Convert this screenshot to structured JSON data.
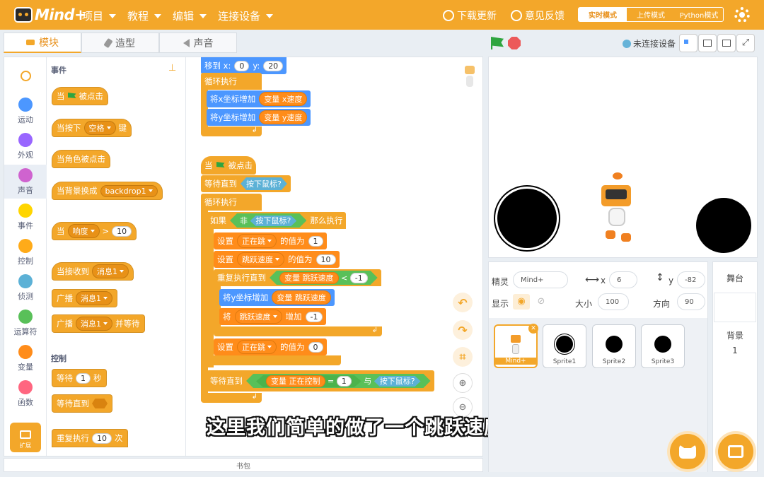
{
  "app": {
    "logo_text": "Mind+"
  },
  "menu": [
    {
      "label": "项目"
    },
    {
      "label": "教程"
    },
    {
      "label": "编辑"
    },
    {
      "label": "连接设备"
    }
  ],
  "topright": {
    "download": "下载更新",
    "feedback": "意见反馈",
    "modes": [
      "实时模式",
      "上传模式",
      "Python模式"
    ]
  },
  "tabs": [
    {
      "label": "模块",
      "icon": "blocks-icon"
    },
    {
      "label": "造型",
      "icon": "brush-icon"
    },
    {
      "label": "声音",
      "icon": "speaker-icon"
    }
  ],
  "categories": [
    {
      "label": "",
      "icon": "search-icon"
    },
    {
      "label": "运动",
      "color": "#4c97ff"
    },
    {
      "label": "外观",
      "color": "#9966ff"
    },
    {
      "label": "声音",
      "color": "#cf63cf"
    },
    {
      "label": "事件",
      "color": "#ffd500"
    },
    {
      "label": "控制",
      "color": "#ffab19"
    },
    {
      "label": "侦测",
      "color": "#5cb1d6"
    },
    {
      "label": "运算符",
      "color": "#59c059"
    },
    {
      "label": "变量",
      "color": "#ff8c1a"
    },
    {
      "label": "函数",
      "color": "#ff6680"
    }
  ],
  "extension_label": "扩展",
  "palette": {
    "events_header": "事件",
    "control_header": "控制",
    "b_flag": "当",
    "b_flag2": "被点击",
    "b_key": "当按下",
    "b_key_dd": "空格",
    "b_key2": "键",
    "b_sprite_click": "当角色被点击",
    "b_backdrop": "当背景换成",
    "b_backdrop_dd": "backdrop1",
    "b_loud": "当",
    "b_loud_dd": "响度",
    "b_loud_op": ">",
    "b_loud_val": "10",
    "b_recv": "当接收到",
    "b_recv_dd": "消息1",
    "b_bcast": "广播",
    "b_bcast_dd": "消息1",
    "b_bcastw": "广播",
    "b_bcastw_dd": "消息1",
    "b_bcastw2": "并等待",
    "b_wait": "等待",
    "b_wait_val": "1",
    "b_wait2": "秒",
    "b_waituntil": "等待直到",
    "b_repeat": "重复执行",
    "b_repeat_val": "10",
    "b_repeat2": "次"
  },
  "script": {
    "goto": "移到 x:",
    "goto_x": "0",
    "goto_y_label": "y:",
    "goto_y": "20",
    "forever1": "循环执行",
    "changex": "将x坐标增加",
    "var_label": "变量",
    "xspeed": "x速度",
    "changey": "将y坐标增加",
    "yspeed": "y速度",
    "when": "当",
    "clicked": "被点击",
    "waituntil": "等待直到",
    "mousedown": "按下鼠标?",
    "forever2": "循环执行",
    "if": "如果",
    "not": "非",
    "then": "那么执行",
    "set": "设置",
    "jumping": "正在跳",
    "setval_label": "的值为",
    "one": "1",
    "jumpspeed": "跳跃速度",
    "ten": "10",
    "repeatuntil": "重复执行直到",
    "lt": "<",
    "changey2": "将y坐标增加",
    "change": "将",
    "add": "增加",
    "neg1": "-1",
    "zero": "0",
    "waituntil2": "等待直到",
    "controlling": "正在控制",
    "eq": "=",
    "and": "与"
  },
  "bag_label": "书包",
  "subtitle": "这里我们简单的做了一个跳跃速度啊",
  "stagebar": {
    "connection": "未连接设备"
  },
  "sprite_info": {
    "sprite_label": "精灵",
    "sprite_name": "Mind+",
    "x_label": "x",
    "x": "6",
    "y_label": "y",
    "y": "-82",
    "show_label": "显示",
    "size_label": "大小",
    "size": "100",
    "direction_label": "方向",
    "direction": "90"
  },
  "sprites": [
    {
      "name": "Mind+",
      "selected": true
    },
    {
      "name": "Sprite1"
    },
    {
      "name": "Sprite2"
    },
    {
      "name": "Sprite3"
    }
  ],
  "stage_panel": {
    "title": "舞台",
    "backdrop_label": "背景",
    "backdrop_count": "1"
  }
}
